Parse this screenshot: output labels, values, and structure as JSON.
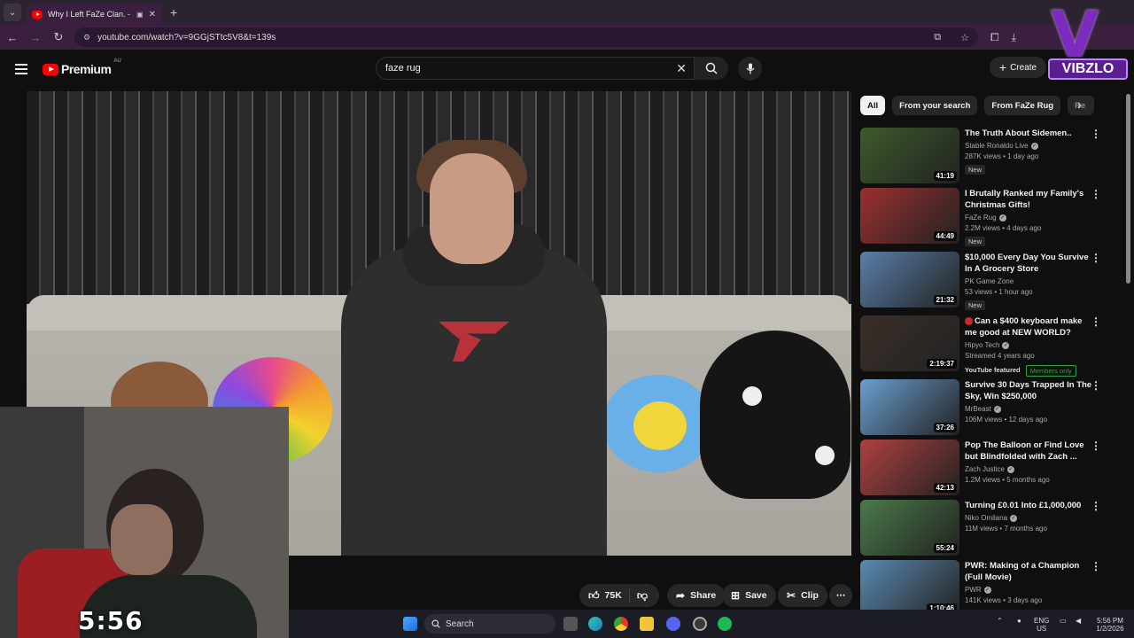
{
  "browser": {
    "tab_title": "Why I Left FaZe Clan. - YouTube",
    "url": "youtube.com/watch?v=9GGjSTtc5V8&t=139s"
  },
  "youtube": {
    "logo_text": "Premium",
    "country_code": "AU",
    "search_value": "faze rug",
    "create_label": "Create"
  },
  "watermark": {
    "letter": "V",
    "name": "VIBZLO"
  },
  "player": {
    "stream_timer": "5:56"
  },
  "actions": {
    "likes": "75K",
    "share": "Share",
    "save": "Save",
    "clip": "Clip"
  },
  "chips": [
    "All",
    "From your search",
    "From FaZe Rug",
    "Re"
  ],
  "recommendations": [
    {
      "title": "The Truth About Sidemen..",
      "channel": "Stable Ronaldo Live",
      "verified": true,
      "views": "287K views • 1 day ago",
      "badge": "New",
      "duration": "41:19",
      "thumb_color": "#3d5a2a"
    },
    {
      "title": "I Brutally Ranked my Family's Christmas Gifts!",
      "channel": "FaZe Rug",
      "verified": true,
      "views": "2.2M views • 4 days ago",
      "badge": "New",
      "duration": "44:49",
      "thumb_color": "#9b2f2f"
    },
    {
      "title": "$10,000 Every Day You Survive In A Grocery Store",
      "channel": "PK Game Zone",
      "verified": false,
      "views": "53 views • 1 hour ago",
      "badge": "New",
      "duration": "21:32",
      "thumb_color": "#5a7fa8"
    },
    {
      "title": "Can a $400 keyboard make me good at NEW WORLD?",
      "channel": "Hipyo Tech",
      "verified": true,
      "views": "Streamed 4 years ago",
      "badge": "YouTube featured",
      "badge2": "Members only",
      "duration": "2:19:37",
      "thumb_color": "#3a2f28"
    },
    {
      "title": "Survive 30 Days Trapped In The Sky, Win $250,000",
      "channel": "MrBeast",
      "verified": true,
      "views": "106M views • 12 days ago",
      "badge": "",
      "duration": "37:26",
      "thumb_color": "#6a9fd0"
    },
    {
      "title": "Pop The Balloon or Find Love but Blindfolded with Zach ...",
      "channel": "Zach Justice",
      "verified": true,
      "views": "1.2M views • 5 months ago",
      "badge": "",
      "duration": "42:13",
      "thumb_color": "#b04040"
    },
    {
      "title": "Turning £0.01 Into £1,000,000",
      "channel": "Niko Omilana",
      "verified": true,
      "views": "11M views • 7 months ago",
      "badge": "",
      "duration": "55:24",
      "thumb_color": "#4a7a4a"
    },
    {
      "title": "PWR: Making of a Champion (Full Movie)",
      "channel": "PWR",
      "verified": true,
      "views": "141K views • 3 days ago",
      "badge": "",
      "duration": "1:10:46",
      "thumb_color": "#5a8ab0"
    }
  ],
  "taskbar": {
    "search": "Search",
    "lang": "ENG",
    "region": "US",
    "time": "5:56 PM",
    "date": "1/2/2026"
  }
}
